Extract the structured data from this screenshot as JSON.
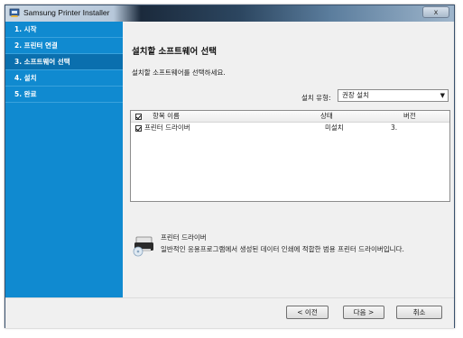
{
  "window": {
    "title": "Samsung Printer Installer",
    "close_glyph": "x"
  },
  "sidebar": {
    "steps": [
      {
        "label": "1. 시작"
      },
      {
        "label": "2. 프린터 연결"
      },
      {
        "label": "3. 소프트웨어 선택"
      },
      {
        "label": "4. 설치"
      },
      {
        "label": "5. 완료"
      }
    ],
    "active_index": 2
  },
  "main": {
    "title": "설치할 소프트웨어 선택",
    "description": "설치할 소프트웨어를 선택하세요.",
    "install_type_label": "설치 유형:",
    "install_type_value": "권장 설치"
  },
  "software_list": {
    "columns": [
      "항목 이름",
      "상태",
      "버전"
    ],
    "rows": [
      {
        "name": "프린터 드라이버",
        "status": "미설치",
        "version": "3.",
        "checked": true
      }
    ]
  },
  "info": {
    "icon": "printer-driver-icon",
    "title": "프린터 드라이버",
    "description": "일반적인 응용프로그램에서 생성된 데이터 인쇄에 적합한 범용 프린터 드라이버입니다."
  },
  "buttons": {
    "back": "< 이전",
    "next": "다음 >",
    "cancel": "취소"
  },
  "colors": {
    "sidebar": "#108ad0",
    "sidebar_active": "#0a6fae"
  }
}
